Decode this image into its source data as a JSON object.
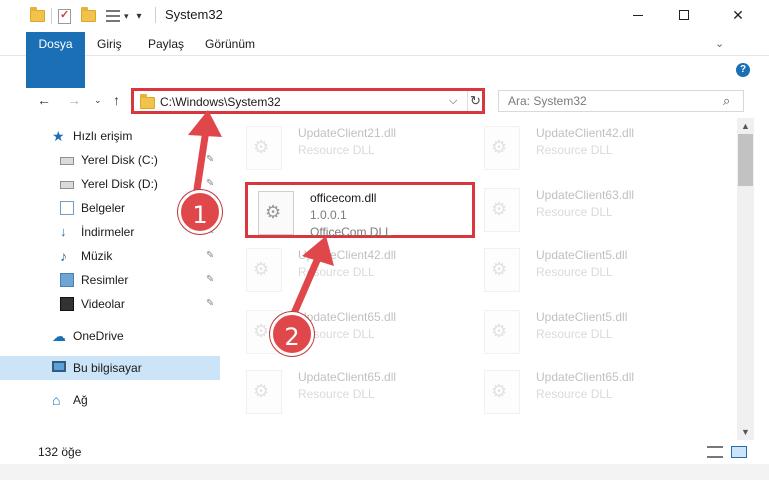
{
  "window": {
    "title": "System32",
    "controls": {
      "minimize": "",
      "maximize": "",
      "close": "✕"
    }
  },
  "ribbon": {
    "tabs": [
      "Dosya",
      "Giriş",
      "Paylaş",
      "Görünüm"
    ],
    "help": "?"
  },
  "address": {
    "path": "C:\\Windows\\System32",
    "refresh": "↻",
    "dropdown": "⌵"
  },
  "search": {
    "placeholder": "Ara: System32"
  },
  "nav": {
    "back": "←",
    "forward": "→",
    "recent": "⌄",
    "up": "↑"
  },
  "sidebar": {
    "items": [
      {
        "label": "Hızlı erişim",
        "icon": "star-icon"
      },
      {
        "label": "Yerel Disk (C:)",
        "icon": "drive-icon"
      },
      {
        "label": "Yerel Disk (D:)",
        "icon": "drive-icon"
      },
      {
        "label": "Belgeler",
        "icon": "documents-icon"
      },
      {
        "label": "İndirmeler",
        "icon": "download-icon"
      },
      {
        "label": "Müzik",
        "icon": "music-icon"
      },
      {
        "label": "Resimler",
        "icon": "pictures-icon"
      },
      {
        "label": "Videolar",
        "icon": "videos-icon"
      },
      {
        "label": "OneDrive",
        "icon": "cloud-icon"
      },
      {
        "label": "Bu bilgisayar",
        "icon": "computer-icon"
      },
      {
        "label": "Ağ",
        "icon": "network-icon"
      }
    ],
    "pin": "📌"
  },
  "files": [
    {
      "name": "UpdateClient21.dll",
      "type": "Resource DLL"
    },
    {
      "name": "UpdateClient42.dll",
      "type": "Resource DLL"
    },
    {
      "name": "officecom.dll",
      "version": "1.0.0.1",
      "type": "OfficeCom DLL"
    },
    {
      "name": "UpdateClient63.dll",
      "type": "Resource DLL"
    },
    {
      "name": "UpdateClient42.dll",
      "type": "Resource DLL"
    },
    {
      "name": "UpdateClient5.dll",
      "type": "Resource DLL"
    },
    {
      "name": "UpdateClient65.dll",
      "type": "Resource DLL"
    },
    {
      "name": "UpdateClient5.dll",
      "type": "Resource DLL"
    },
    {
      "name": "UpdateClient65.dll",
      "type": "Resource DLL"
    },
    {
      "name": "UpdateClient65.dll",
      "type": "Resource DLL"
    }
  ],
  "status": {
    "count": "132 öğe"
  },
  "callouts": [
    "1",
    "2"
  ],
  "colors": {
    "accent": "#1a6fb5",
    "highlight": "#d9363e",
    "selection": "#cce4f7"
  }
}
